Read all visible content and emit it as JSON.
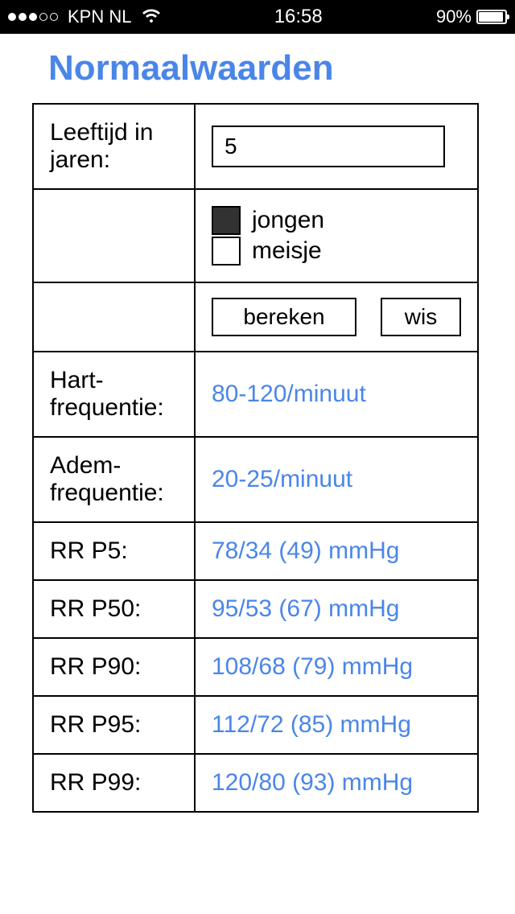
{
  "status_bar": {
    "carrier": "KPN NL",
    "time": "16:58",
    "battery_pct": "90%"
  },
  "title": "Normaalwaarden",
  "form": {
    "age_label": "Leeftijd in jaren:",
    "age_value": "5",
    "gender_boy_label": "jongen",
    "gender_girl_label": "meisje",
    "gender_boy_checked": true,
    "gender_girl_checked": false,
    "calc_button": "bereken",
    "clear_button": "wis"
  },
  "results": {
    "heart_rate_label": "Hart-frequentie:",
    "heart_rate_value": "80-120/minuut",
    "resp_rate_label": "Adem-frequentie:",
    "resp_rate_value": "20-25/minuut",
    "rr_p5_label": "RR P5:",
    "rr_p5_value": "78/34 (49) mmHg",
    "rr_p50_label": "RR P50:",
    "rr_p50_value": "95/53 (67) mmHg",
    "rr_p90_label": "RR P90:",
    "rr_p90_value": "108/68 (79) mmHg",
    "rr_p95_label": "RR P95:",
    "rr_p95_value": "112/72 (85) mmHg",
    "rr_p99_label": "RR P99:",
    "rr_p99_value": "120/80 (93) mmHg"
  }
}
